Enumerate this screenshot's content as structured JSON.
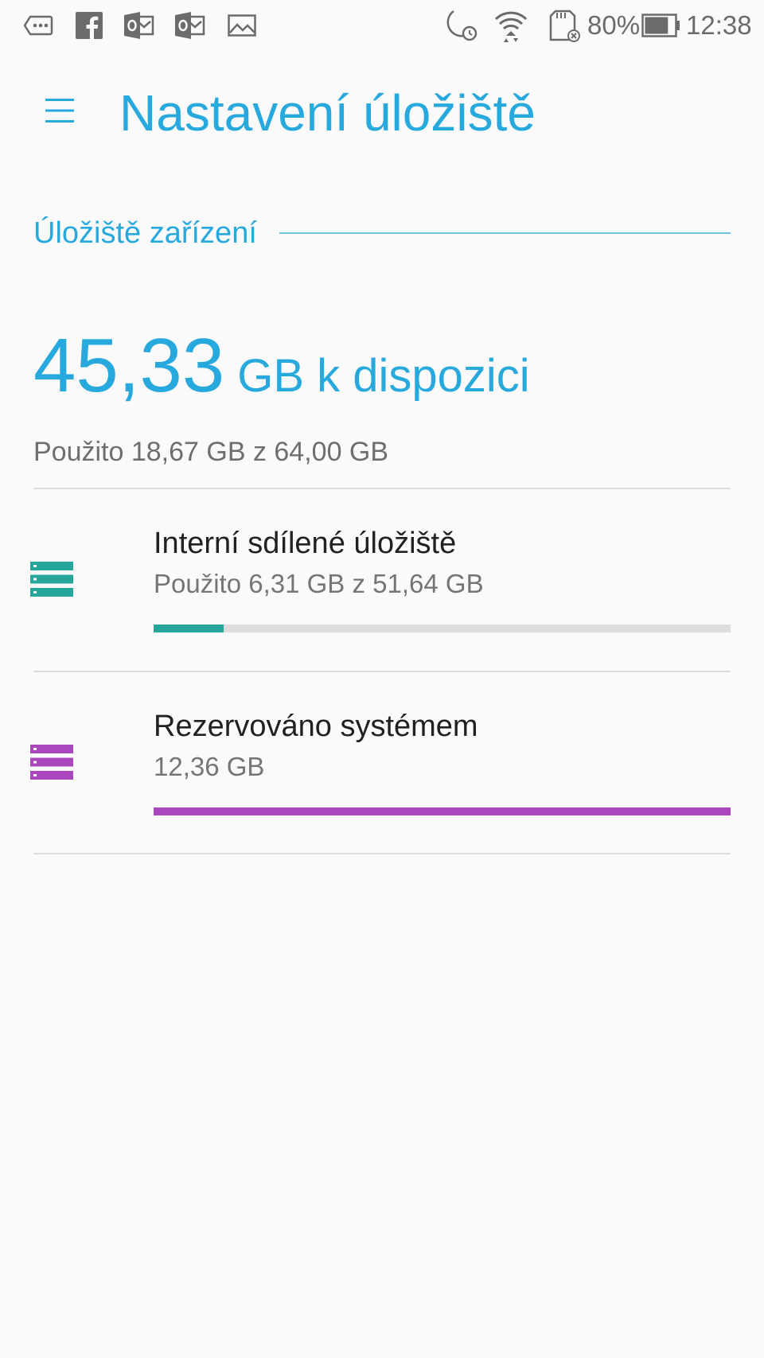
{
  "status_bar": {
    "icons": [
      "message-icon",
      "facebook-icon",
      "outlook-icon",
      "outlook-icon",
      "gallery-icon",
      "do-not-disturb-alarm-icon",
      "wifi-icon",
      "sd-card-icon",
      "battery-icon"
    ],
    "battery_percent_label": "80%",
    "battery_level": 0.8,
    "time": "12:38"
  },
  "app_bar": {
    "menu_icon": "menu-icon",
    "title": "Nastavení úložiště"
  },
  "section": {
    "title": "Úložiště zařízení"
  },
  "summary": {
    "free_amount": "45,33",
    "free_label": "GB k dispozici",
    "used_text": "Použito 18,67 GB z 64,00 GB"
  },
  "items": [
    {
      "icon": "storage-icon",
      "title": "Interní sdílené úložiště",
      "subtitle": "Použito 6,31 GB z 51,64 GB",
      "used_fraction": 0.122,
      "color": "#26a69a"
    },
    {
      "icon": "storage-icon",
      "title": "Rezervováno systémem",
      "subtitle": "12,36 GB",
      "used_fraction": 1.0,
      "color": "#ab47bc"
    }
  ],
  "colors": {
    "accent": "#28a9dd",
    "background": "#fafafa",
    "divider": "#dcdcdc"
  }
}
